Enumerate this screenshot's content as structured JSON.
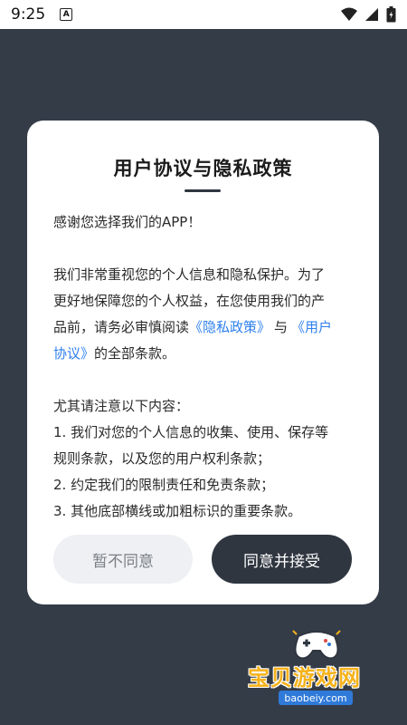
{
  "status_bar": {
    "time": "9:25",
    "notification_icon": "A",
    "icons": [
      "wifi-icon",
      "signal-icon",
      "battery-icon"
    ]
  },
  "dialog": {
    "title": "用户协议与隐私政策",
    "greeting": "感谢您选择我们的APP！",
    "para1_line1": "我们非常重视您的个人信息和隐私保护。为了",
    "para1_line2": "更好地保障您的个人权益，在您使用我们的产",
    "para1_line3_a": "品前，请务必审慎阅读",
    "link_privacy": "《隐私政策》",
    "para1_line3_b": "与",
    "link_agreement_a": "《用户",
    "link_agreement_b": "协议》",
    "para1_line4": "的全部条款。",
    "notice_title": "尤其请注意以下内容：",
    "item1_line1": "1. 我们对您的个人信息的收集、使用、保存等",
    "item1_line2": "规则条款，以及您的用户权利条款；",
    "item2": "2. 约定我们的限制责任和免责条款；",
    "item3": "3. 其他底部横线或加粗标识的重要条款。",
    "decline_label": "暂不同意",
    "accept_label": "同意并接受"
  },
  "watermark": {
    "name": "宝贝游戏网",
    "url": "baobeiy.com"
  },
  "colors": {
    "backdrop": "#343c48",
    "accent_dark": "#2f3640",
    "link": "#2f80ed"
  }
}
